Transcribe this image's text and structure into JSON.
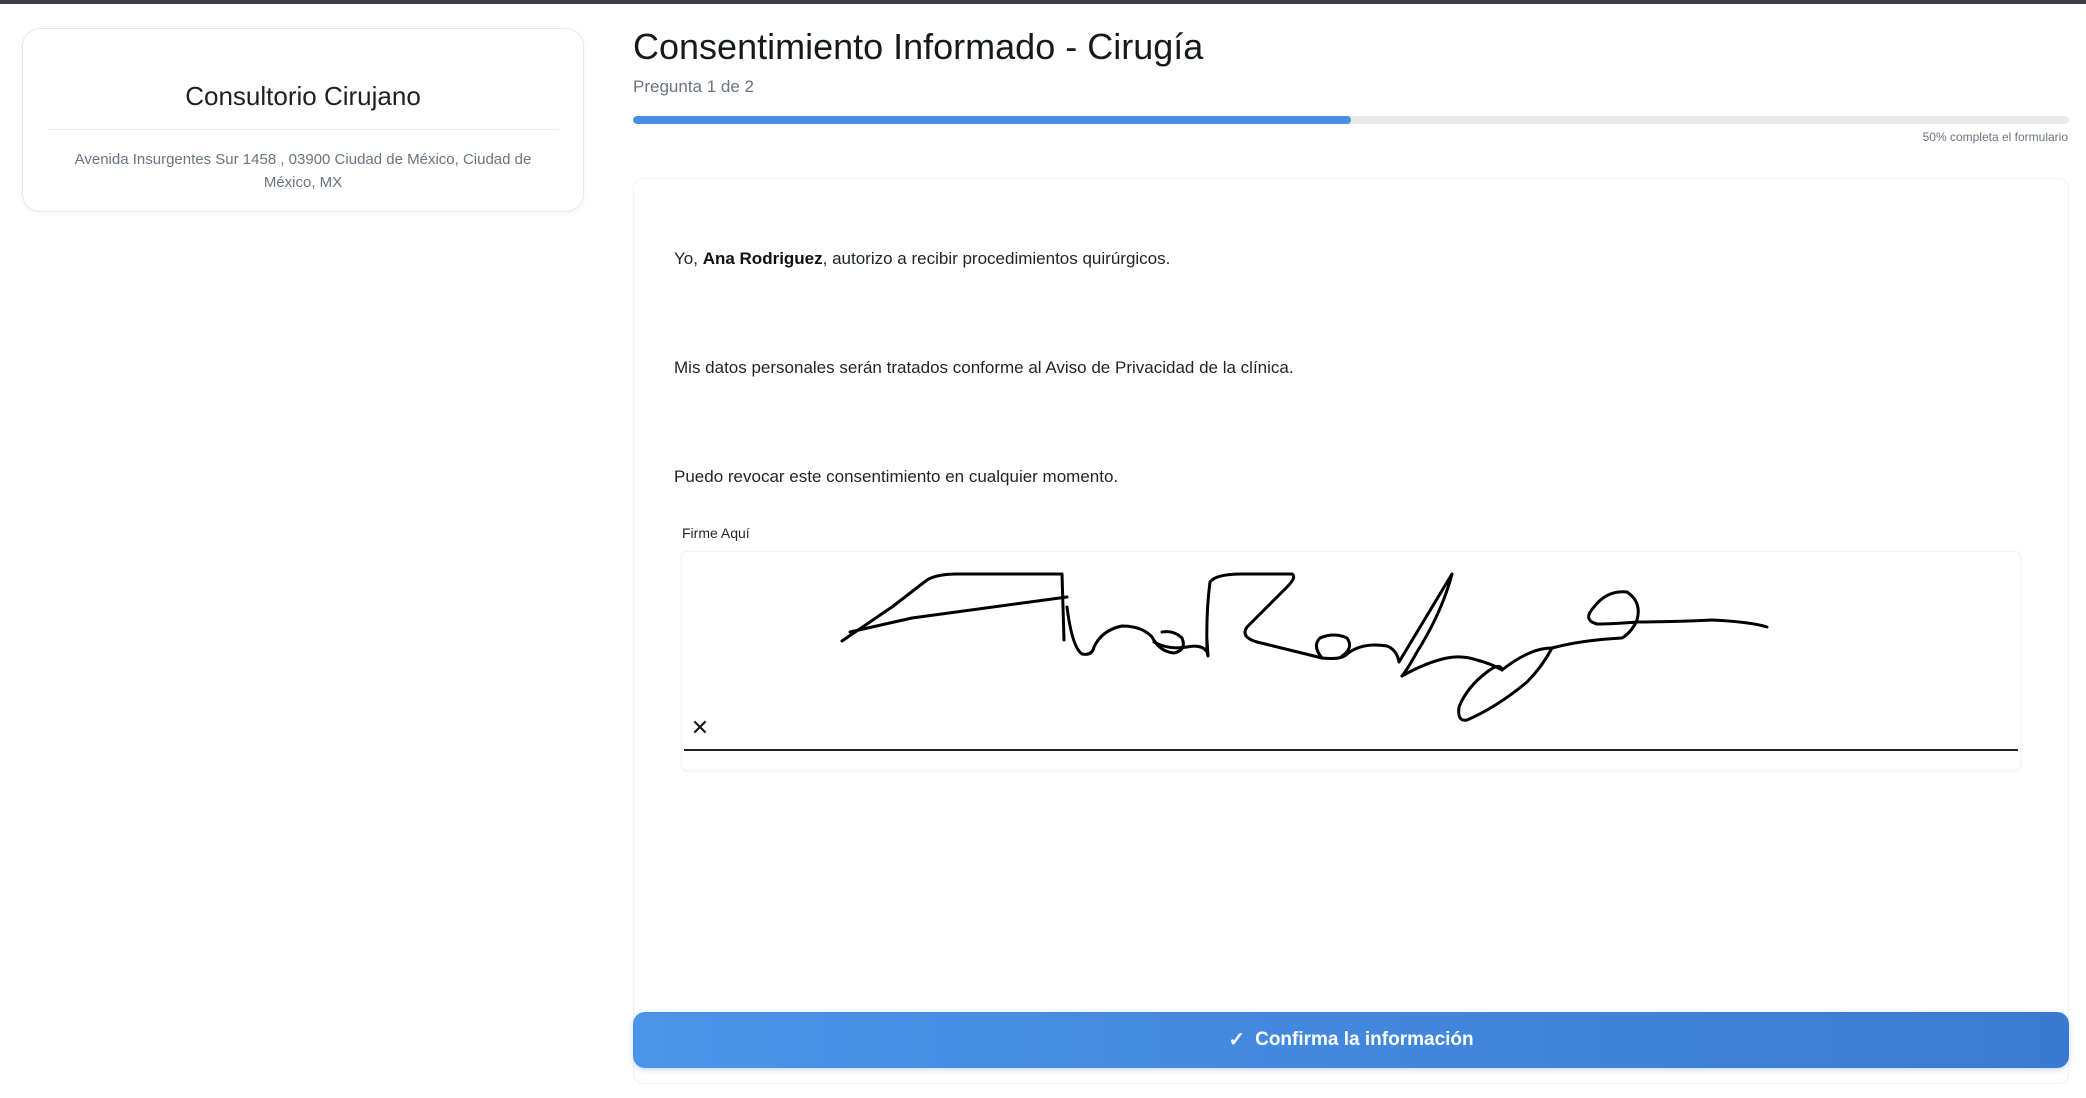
{
  "clinic": {
    "name": "Consultorio Cirujano",
    "address": "Avenida Insurgentes Sur 1458 , 03900 Ciudad de México, Ciudad de México, MX"
  },
  "form": {
    "title": "Consentimiento Informado - Cirugía",
    "question_counter": "Pregunta 1 de 2",
    "progress_fraction": 0.5,
    "progress_text": "50% completa el formulario"
  },
  "statements": {
    "s1_prefix": "Yo, ",
    "patient_name": "Ana Rodriguez",
    "s1_suffix": ", autorizo a recibir procedimientos quirúrgicos.",
    "s2": "Mis datos personales serán tratados conforme al Aviso de Privacidad de la clínica.",
    "s3": "Puedo revocar este consentimiento en cualquier momento."
  },
  "signature": {
    "label": "Firme Aquí",
    "clear_icon": "close-icon",
    "signature_image_text": "Ana Rodriguez"
  },
  "actions": {
    "confirm_label": "Confirma la información",
    "confirm_icon": "check-icon",
    "accent_color": "#4a90e2"
  }
}
